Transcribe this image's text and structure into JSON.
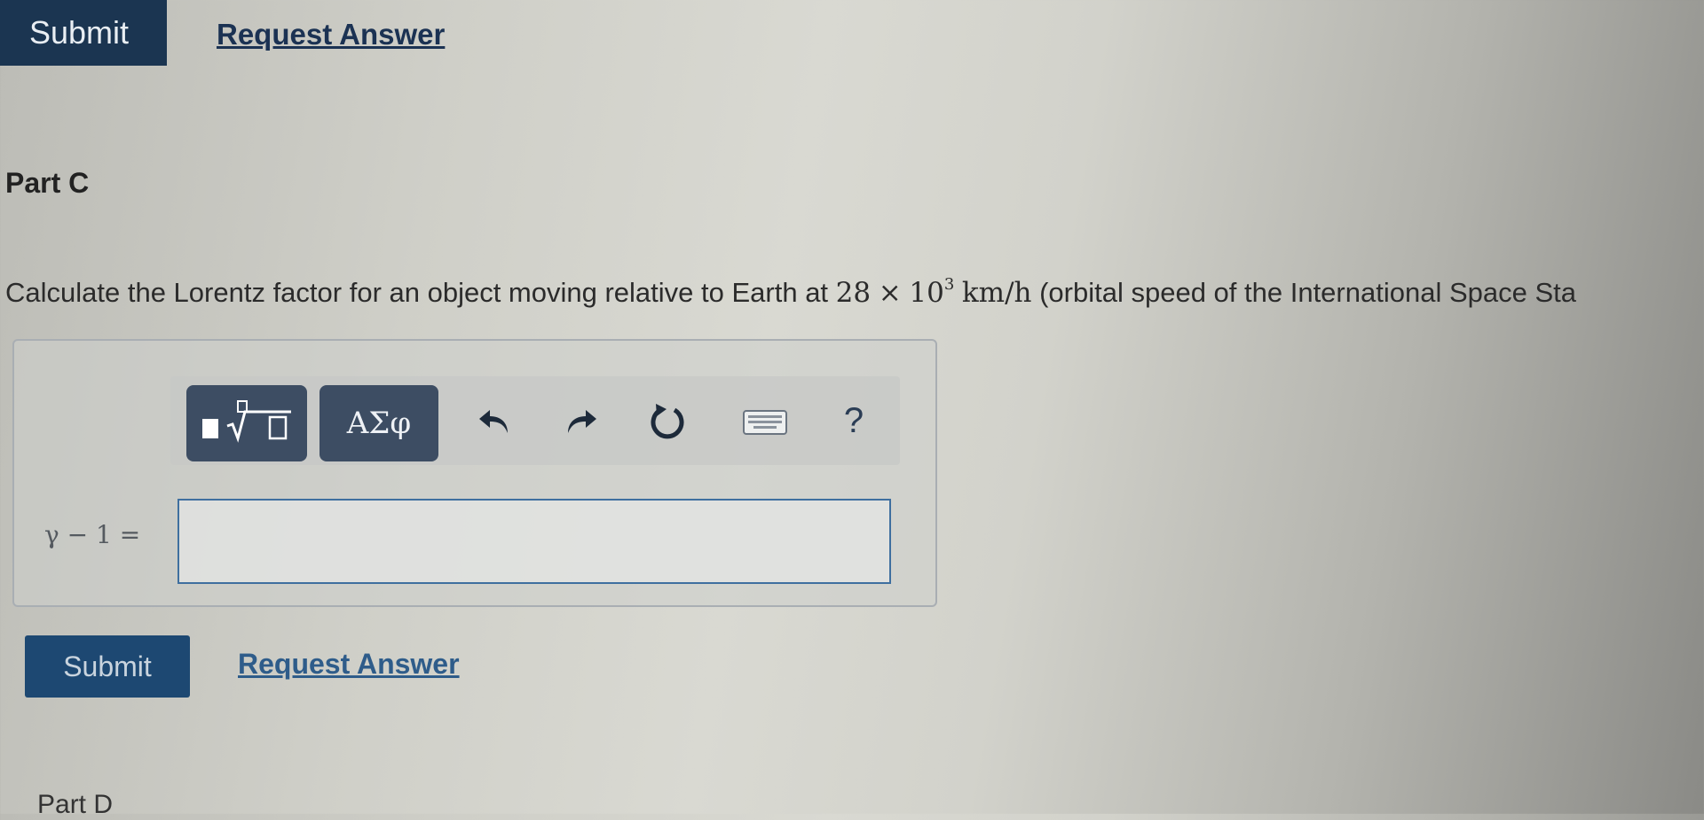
{
  "top_actions": {
    "submit_label": "Submit",
    "request_answer_label": "Request Answer"
  },
  "part_c": {
    "title": "Part C",
    "question": {
      "prefix": "Calculate the Lorentz factor for an object moving relative to Earth at ",
      "value": "28",
      "times": "×",
      "base": "10",
      "exponent": "3",
      "unit": "km/h",
      "suffix": " (orbital speed of the International Space Sta"
    },
    "toolbar": {
      "greek_label": "ΑΣφ",
      "help_label": "?"
    },
    "equation_label": "γ − 1 =",
    "answer_value": "",
    "submit_label": "Submit",
    "request_answer_label": "Request Answer"
  },
  "part_d": {
    "title": "Part D"
  },
  "colors": {
    "submit_dark": "#1b3551",
    "submit_blue": "#1d4872",
    "link": "#2e5c8a",
    "toolbar_button": "#3d4d63",
    "input_border": "#3f6f9f"
  },
  "icons": [
    "templates-icon",
    "undo-icon",
    "redo-icon",
    "reset-icon",
    "keyboard-icon",
    "help-icon"
  ]
}
